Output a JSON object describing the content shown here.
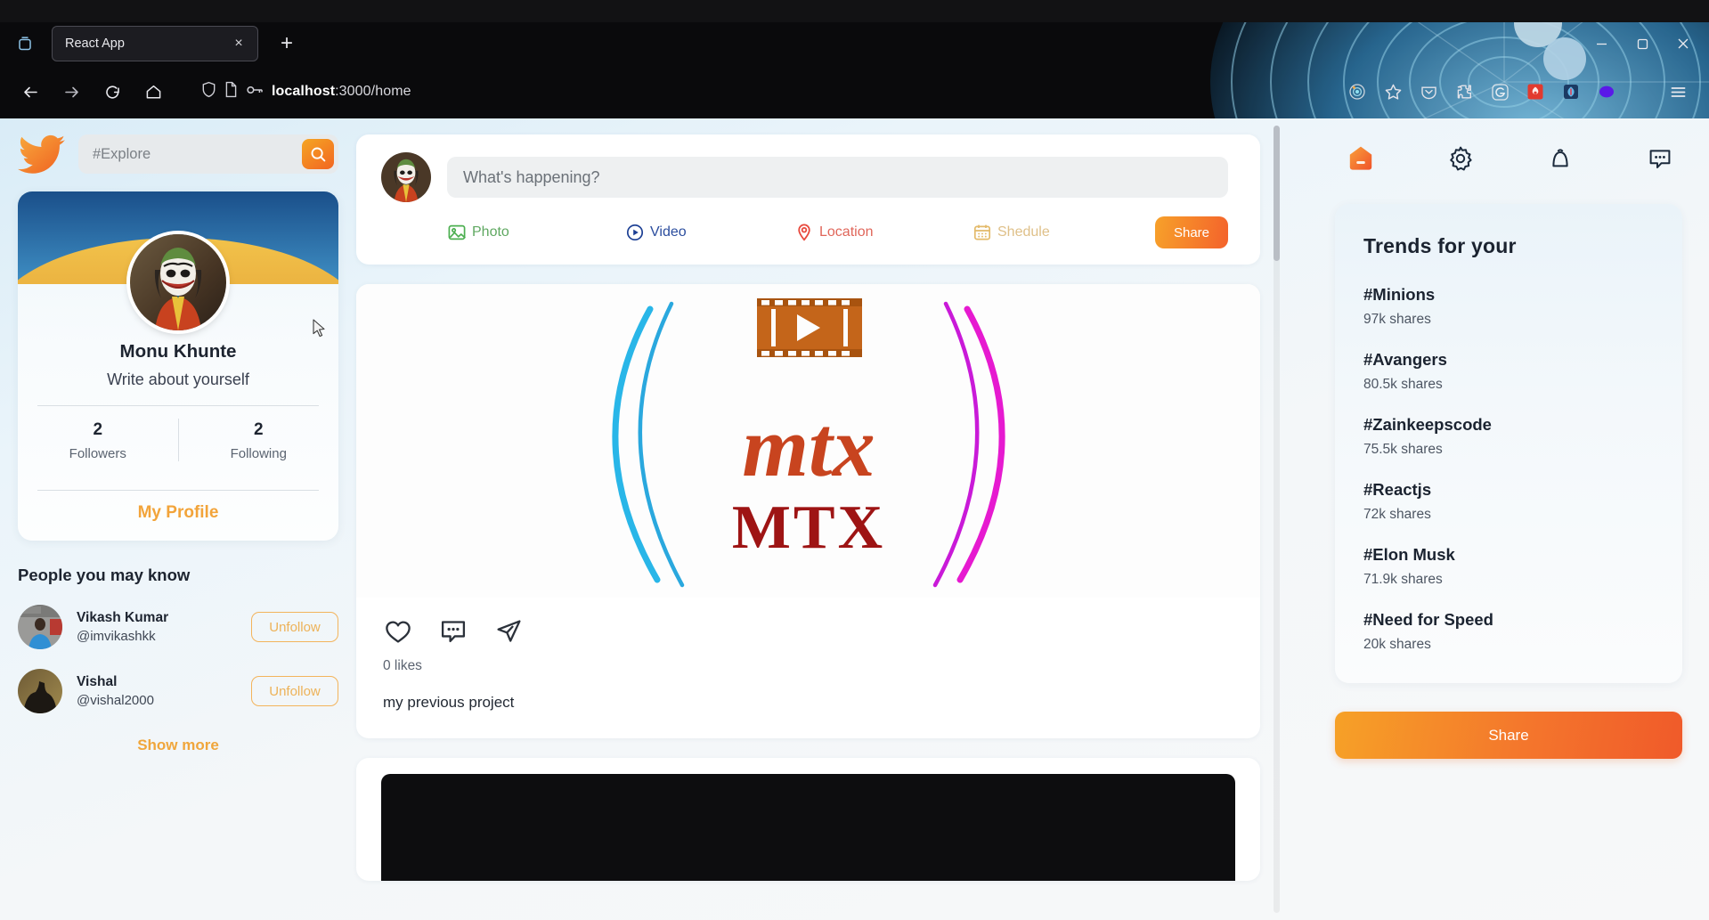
{
  "browser": {
    "tab_title": "React App",
    "tab_close_label": "×",
    "newtab_label": "+",
    "url_host": "localhost",
    "url_path": ":3000/home",
    "icons": {
      "tab_list": "tab-list-icon",
      "back": "back-arrow-icon",
      "forward": "forward-arrow-icon",
      "reload": "reload-icon",
      "home": "home-icon",
      "shield": "shield-icon",
      "page": "page-icon",
      "key": "key-icon",
      "tracking": "tracking-protection-icon",
      "bookmark": "star-bookmark-icon",
      "pocket": "pocket-icon",
      "extensions": "puzzle-extensions-icon",
      "grammarly": "grammarly-g-icon",
      "ext_red": "red-extension-icon",
      "ext_blue": "blue-extension-icon",
      "ext_purple": "purple-extension-icon",
      "ext_orange": "orange-extension-icon",
      "menu": "hamburger-menu-icon",
      "minimize": "minimize-icon",
      "maximize": "maximize-icon",
      "close": "close-window-icon"
    }
  },
  "sidebar": {
    "logo": "twitter-bird-logo",
    "search": {
      "placeholder": "#Explore",
      "value": "",
      "button_icon": "search-icon"
    },
    "profile": {
      "name": "Monu Khunte",
      "bio": "Write about yourself",
      "followers_count": "2",
      "followers_label": "Followers",
      "following_count": "2",
      "following_label": "Following",
      "my_profile_label": "My Profile"
    },
    "pymk_title": "People you may know",
    "people": [
      {
        "name": "Vikash Kumar",
        "handle": "@imvikashkk",
        "action": "Unfollow"
      },
      {
        "name": "Vishal",
        "handle": "@vishal2000",
        "action": "Unfollow"
      }
    ],
    "show_more_label": "Show more"
  },
  "compose": {
    "placeholder": "What's happening?",
    "value": "",
    "actions": [
      {
        "label": "Photo",
        "icon": "photo-icon",
        "color": "#4caf50"
      },
      {
        "label": "Video",
        "icon": "video-icon",
        "color": "#1c3f94"
      },
      {
        "label": "Location",
        "icon": "location-icon",
        "color": "#e8483c"
      },
      {
        "label": "Shedule",
        "icon": "calendar-icon",
        "color": "#e8bb63"
      }
    ],
    "share_label": "Share"
  },
  "feed": {
    "posts": [
      {
        "media_alt": "mtx-logo-image",
        "media_script_text": "mtx",
        "media_bold_text": "MTX",
        "likes": "0 likes",
        "caption": "my previous project",
        "action_icons": [
          "heart-icon",
          "comment-icon",
          "send-icon"
        ]
      },
      {
        "media_alt": "dark-video-thumbnail"
      }
    ]
  },
  "rightbar": {
    "nav_icons": [
      {
        "name": "home-icon",
        "label": "Home"
      },
      {
        "name": "gear-icon",
        "label": "Settings"
      },
      {
        "name": "bell-icon",
        "label": "Notifications"
      },
      {
        "name": "message-icon",
        "label": "Messages"
      }
    ],
    "trends_title": "Trends for your",
    "trends": [
      {
        "tag": "#Minions",
        "shares": "97k shares"
      },
      {
        "tag": "#Avangers",
        "shares": "80.5k shares"
      },
      {
        "tag": "#Zainkeepscode",
        "shares": "75.5k shares"
      },
      {
        "tag": "#Reactjs",
        "shares": "72k shares"
      },
      {
        "tag": "#Elon Musk",
        "shares": "71.9k shares"
      },
      {
        "tag": "#Need for Speed",
        "shares": "20k shares"
      }
    ],
    "share_label": "Share"
  },
  "colors": {
    "accent_orange": "#f0a63c",
    "accent_gradient_start": "#f6a127",
    "accent_gradient_end": "#f05a2a",
    "text_dark": "#1b2330",
    "text_muted": "#5b6370"
  }
}
